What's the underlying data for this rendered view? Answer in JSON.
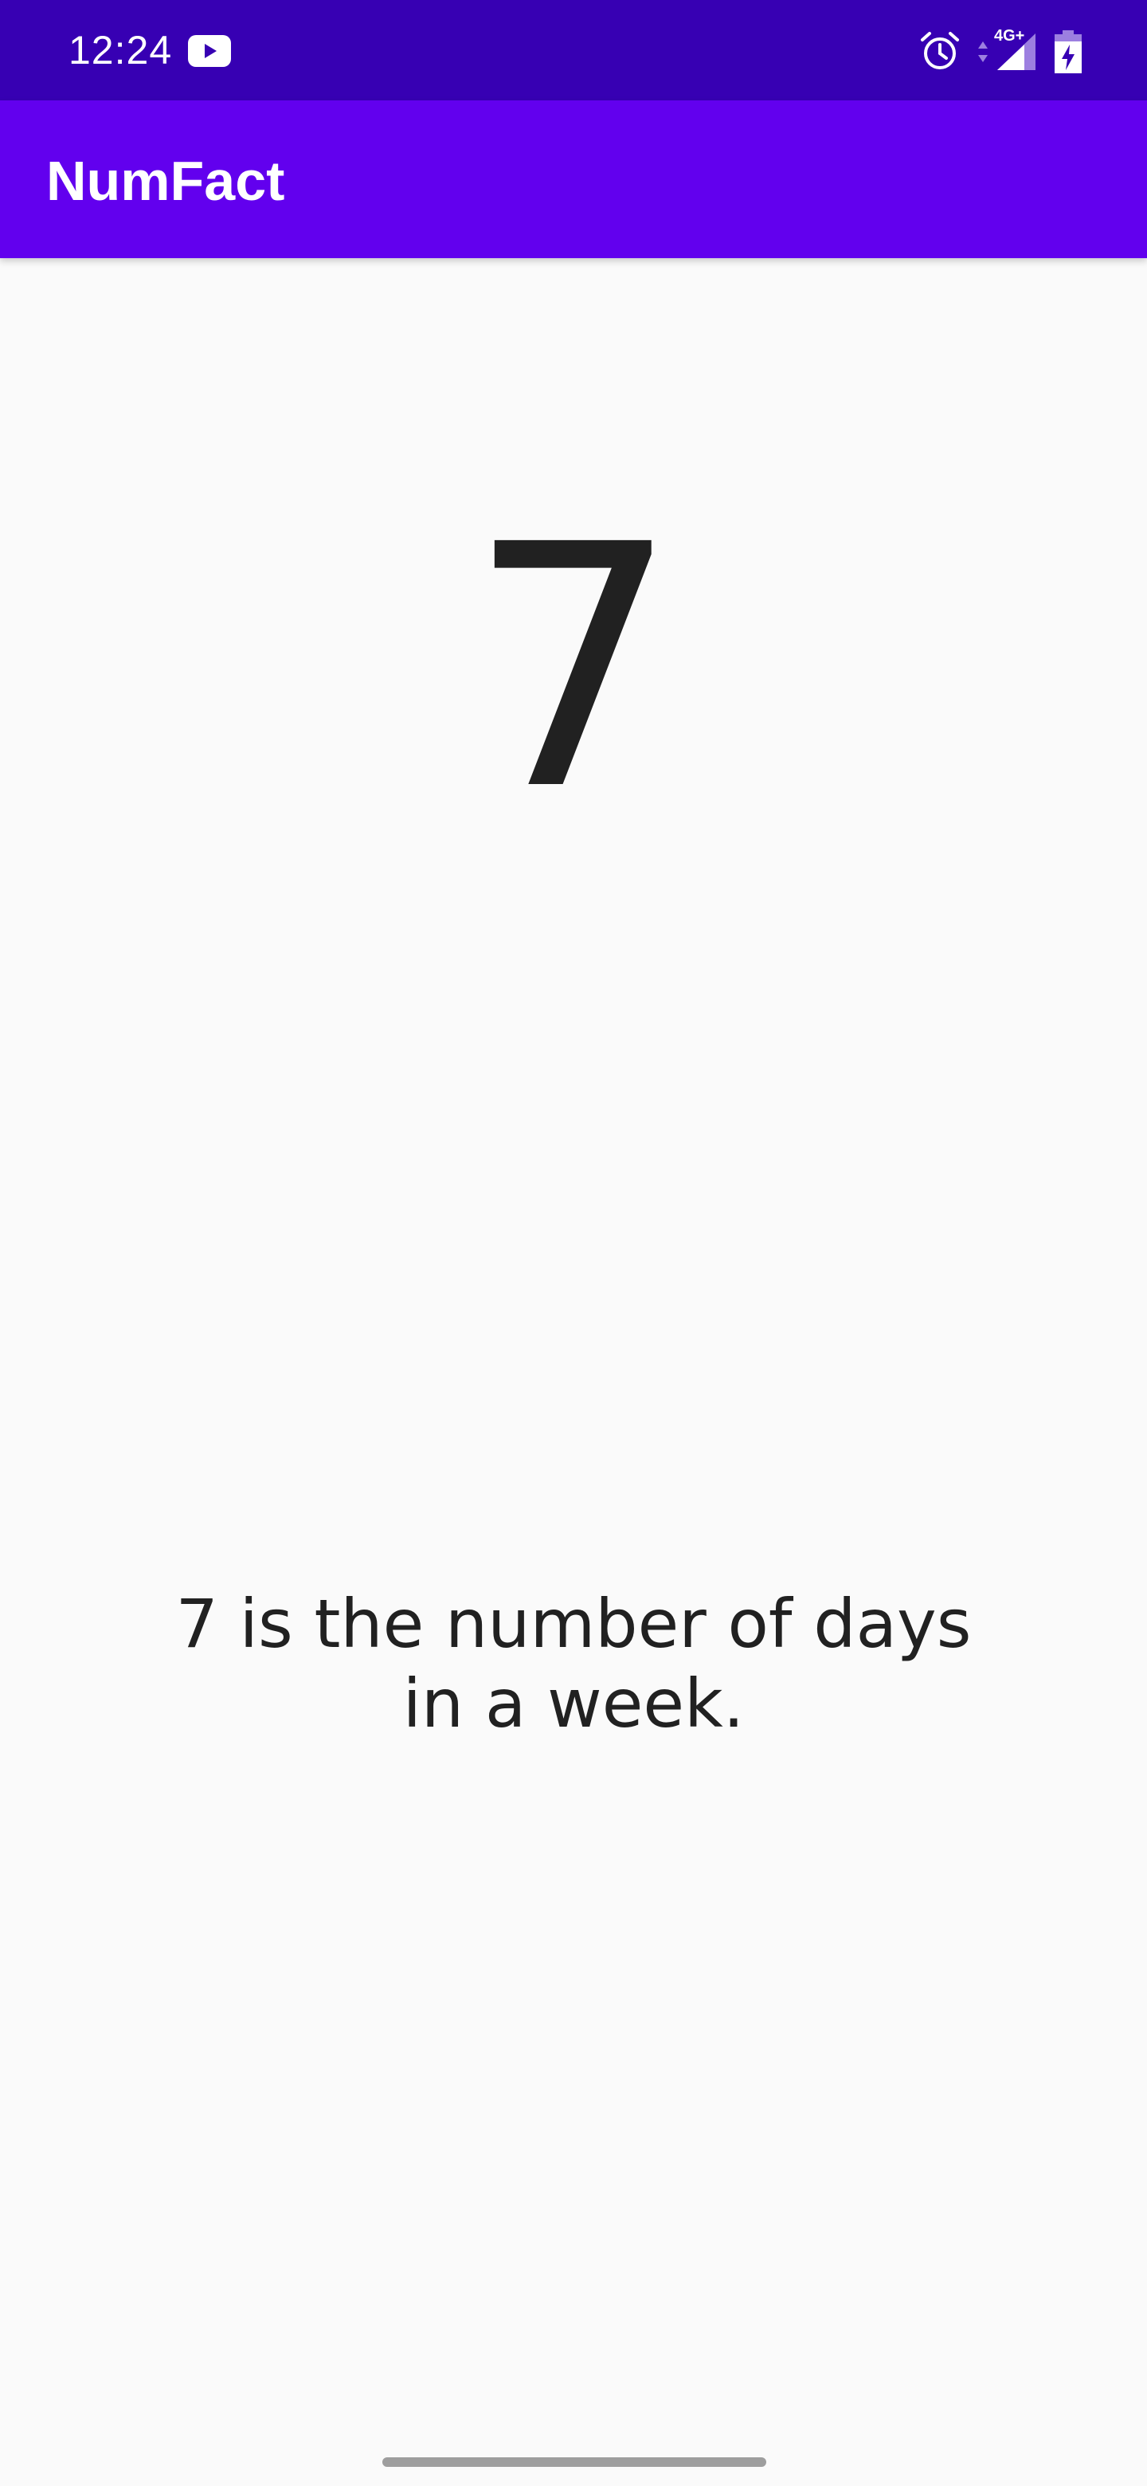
{
  "status_bar": {
    "time": "12:24",
    "network_label": "4G+",
    "icons": [
      "youtube-icon",
      "alarm-icon",
      "data-arrows-icon",
      "signal-icon",
      "battery-charging-icon"
    ],
    "background_color": "#3700b3"
  },
  "app_bar": {
    "title": "NumFact",
    "background_color": "#6200ee"
  },
  "main": {
    "number": "7",
    "fact": "7 is the number of days in a week."
  },
  "colors": {
    "text": "#212121",
    "background": "#fafafa"
  }
}
